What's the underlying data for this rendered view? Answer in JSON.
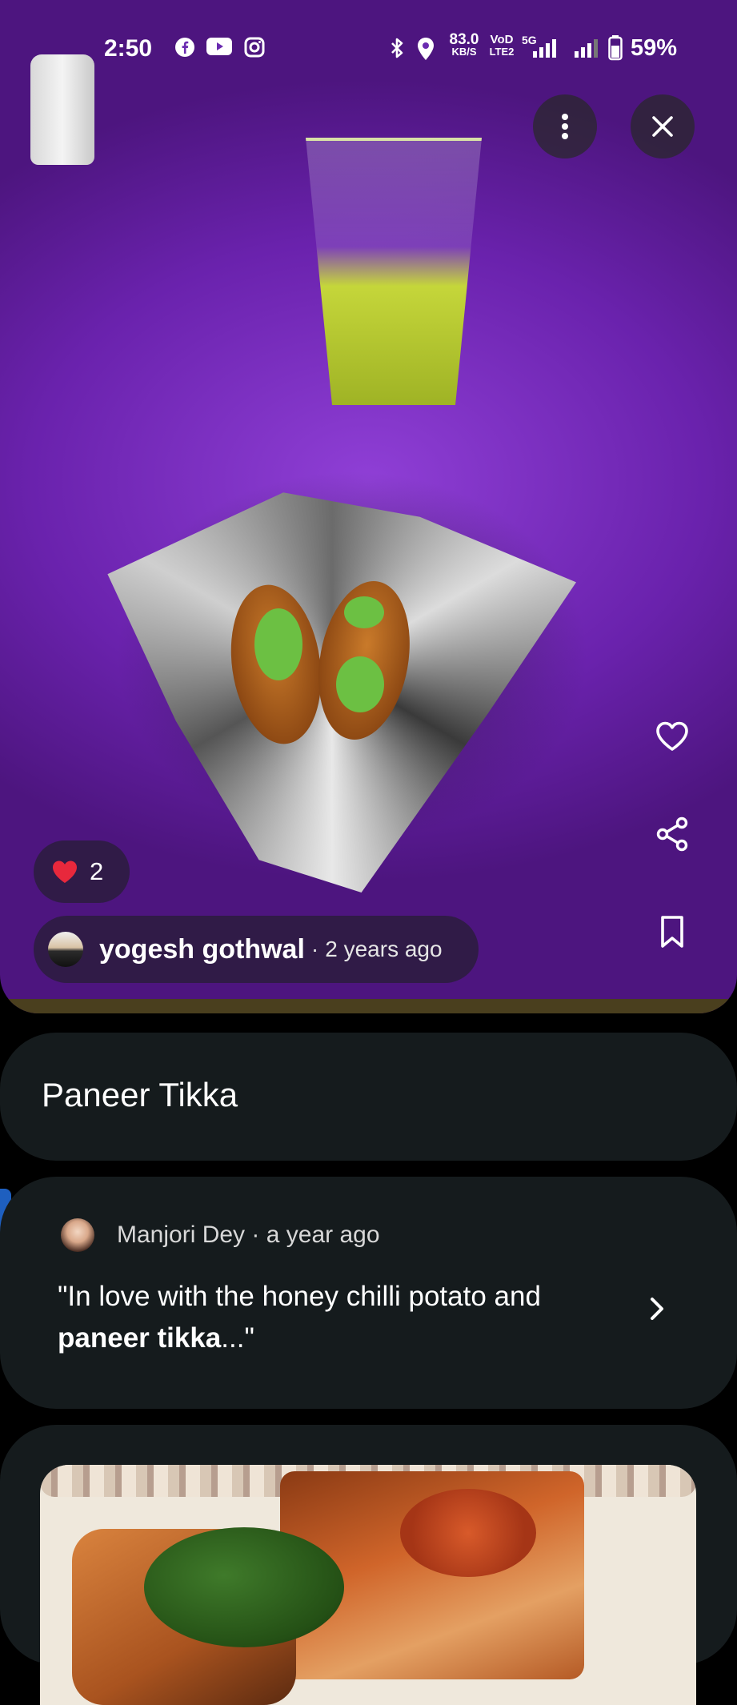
{
  "status_bar": {
    "time": "2:50",
    "network_speed": "83.0",
    "network_speed_unit": "KB/S",
    "volte_top": "VoD",
    "volte_bottom": "LTE2",
    "network_type": "5G",
    "battery": "59%"
  },
  "photo": {
    "likes_count": "2",
    "author_name": "yogesh gothwal",
    "separator": "·",
    "posted_time": "2 years ago"
  },
  "dish": {
    "title": "Paneer Tikka"
  },
  "review": {
    "reviewer": "Manjori Dey",
    "separator": "·",
    "time": "a year ago",
    "text_start": "\"In love with the honey chilli potato and ",
    "text_bold": "paneer tikka",
    "text_end": "...\""
  },
  "colors": {
    "card_bg": "#151b1d",
    "heart_red": "#e8283c",
    "accent_tab": "#1e5fbf"
  }
}
